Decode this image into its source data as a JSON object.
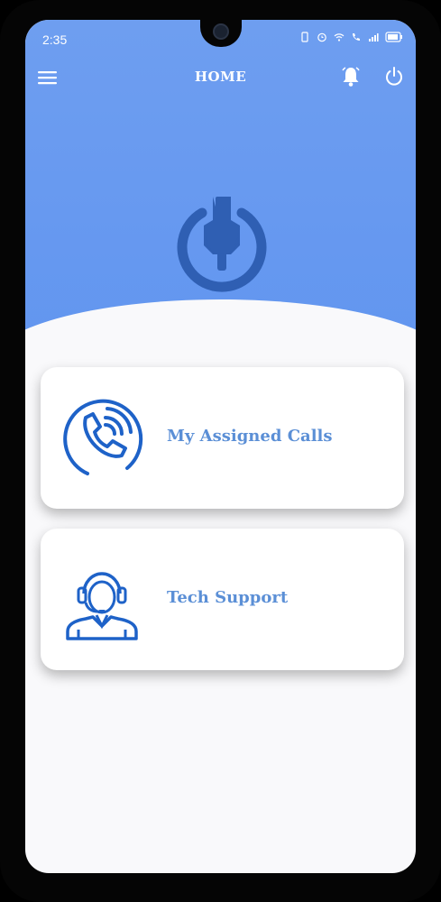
{
  "status_bar": {
    "time": "2:35"
  },
  "app_bar": {
    "title": "HOME",
    "menu_icon": "hamburger-menu-icon",
    "bell_icon": "bell-icon",
    "power_icon": "power-icon"
  },
  "hero": {
    "logo_icon": "power-wrench-logo-icon"
  },
  "cards": [
    {
      "label": "My Assigned Calls",
      "icon": "phone-call-icon"
    },
    {
      "label": "Tech Support",
      "icon": "support-agent-icon"
    }
  ],
  "colors": {
    "primary": "#6799f0",
    "icon_blue": "#1e62c8",
    "logo_blue": "#2f5fb3",
    "label_blue": "#5b8fd6"
  }
}
